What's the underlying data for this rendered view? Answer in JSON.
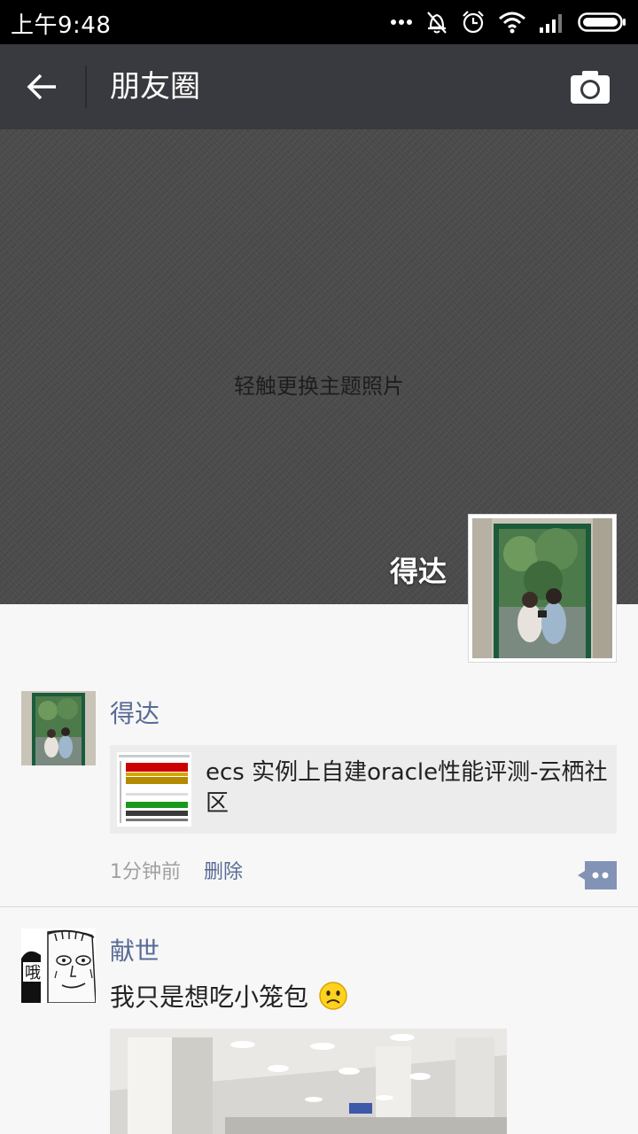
{
  "status": {
    "time": "上午9:48"
  },
  "header": {
    "title": "朋友圈"
  },
  "cover": {
    "hint": "轻触更换主题照片",
    "username": "得达"
  },
  "posts": [
    {
      "name": "得达",
      "share_title": "ecs 实例上自建oracle性能评测-云栖社区",
      "time": "1分钟前",
      "delete_label": "删除"
    },
    {
      "name": "献世",
      "text": "我只是想吃小笼包",
      "emoji": "sad-face",
      "avatar_text": "哦"
    }
  ],
  "colors": {
    "title_bar": "#393a3f",
    "link": "#576b95",
    "cover": "#4a4a4a"
  }
}
